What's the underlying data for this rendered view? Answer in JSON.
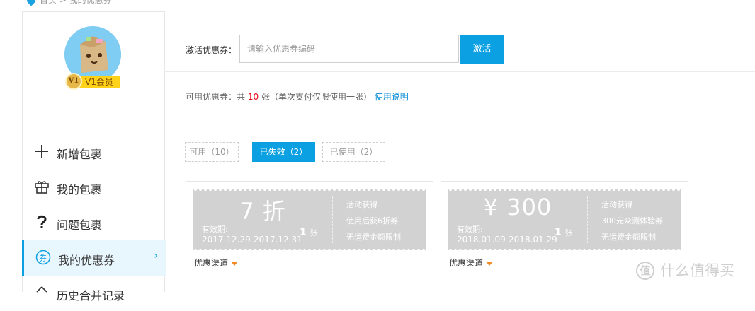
{
  "breadcrumb": {
    "text": "首页 > 我的优惠券"
  },
  "sidebar": {
    "user": {
      "level_badge": "V1",
      "level_label": "V1会员"
    },
    "menu": [
      {
        "label": "新增包裹",
        "icon": "plus-icon"
      },
      {
        "label": "我的包裹",
        "icon": "gift-box-icon"
      },
      {
        "label": "问题包裹",
        "icon": "question-icon"
      },
      {
        "label": "我的优惠券",
        "icon": "coupon-icon",
        "active": true,
        "arrow": "›"
      },
      {
        "label": "历史合并记录",
        "icon": "history-icon"
      }
    ]
  },
  "activate": {
    "label": "激活优惠券：",
    "placeholder": "请输入优惠券编码",
    "button": "激活"
  },
  "summary": {
    "prefix": "可用优惠券：共",
    "count": "10",
    "suffix": "张（单次支付仅限使用一张）",
    "help_link": "使用说明"
  },
  "tabs": [
    {
      "label": "可用（10）",
      "active": false
    },
    {
      "label": "已失效（2）",
      "active": true
    },
    {
      "label": "已使用（2）",
      "active": false
    }
  ],
  "coupons": [
    {
      "value": "7 折",
      "validity_label": "有效期:",
      "validity": "2017.12.29-2017.12.31",
      "quantity": "1",
      "quantity_unit": "张",
      "notes": [
        "活动获得",
        "使用后获6折券",
        "无运费金额限制"
      ],
      "channel_label": "优惠渠道"
    },
    {
      "value": "¥ 300",
      "validity_label": "有效期:",
      "validity": "2018.01.09-2018.01.29",
      "quantity": "1",
      "quantity_unit": "张",
      "notes": [
        "活动获得",
        "300元众测体验券",
        "无运费金额限制"
      ],
      "channel_label": "优惠渠道"
    }
  ],
  "watermark": {
    "text": "什么值得买",
    "mark": "值"
  },
  "colors": {
    "accent": "#0aa0e2",
    "count_red": "#e60012",
    "expired_ticket": "#d2d2d2",
    "dropdown_orange": "#f08a24"
  }
}
